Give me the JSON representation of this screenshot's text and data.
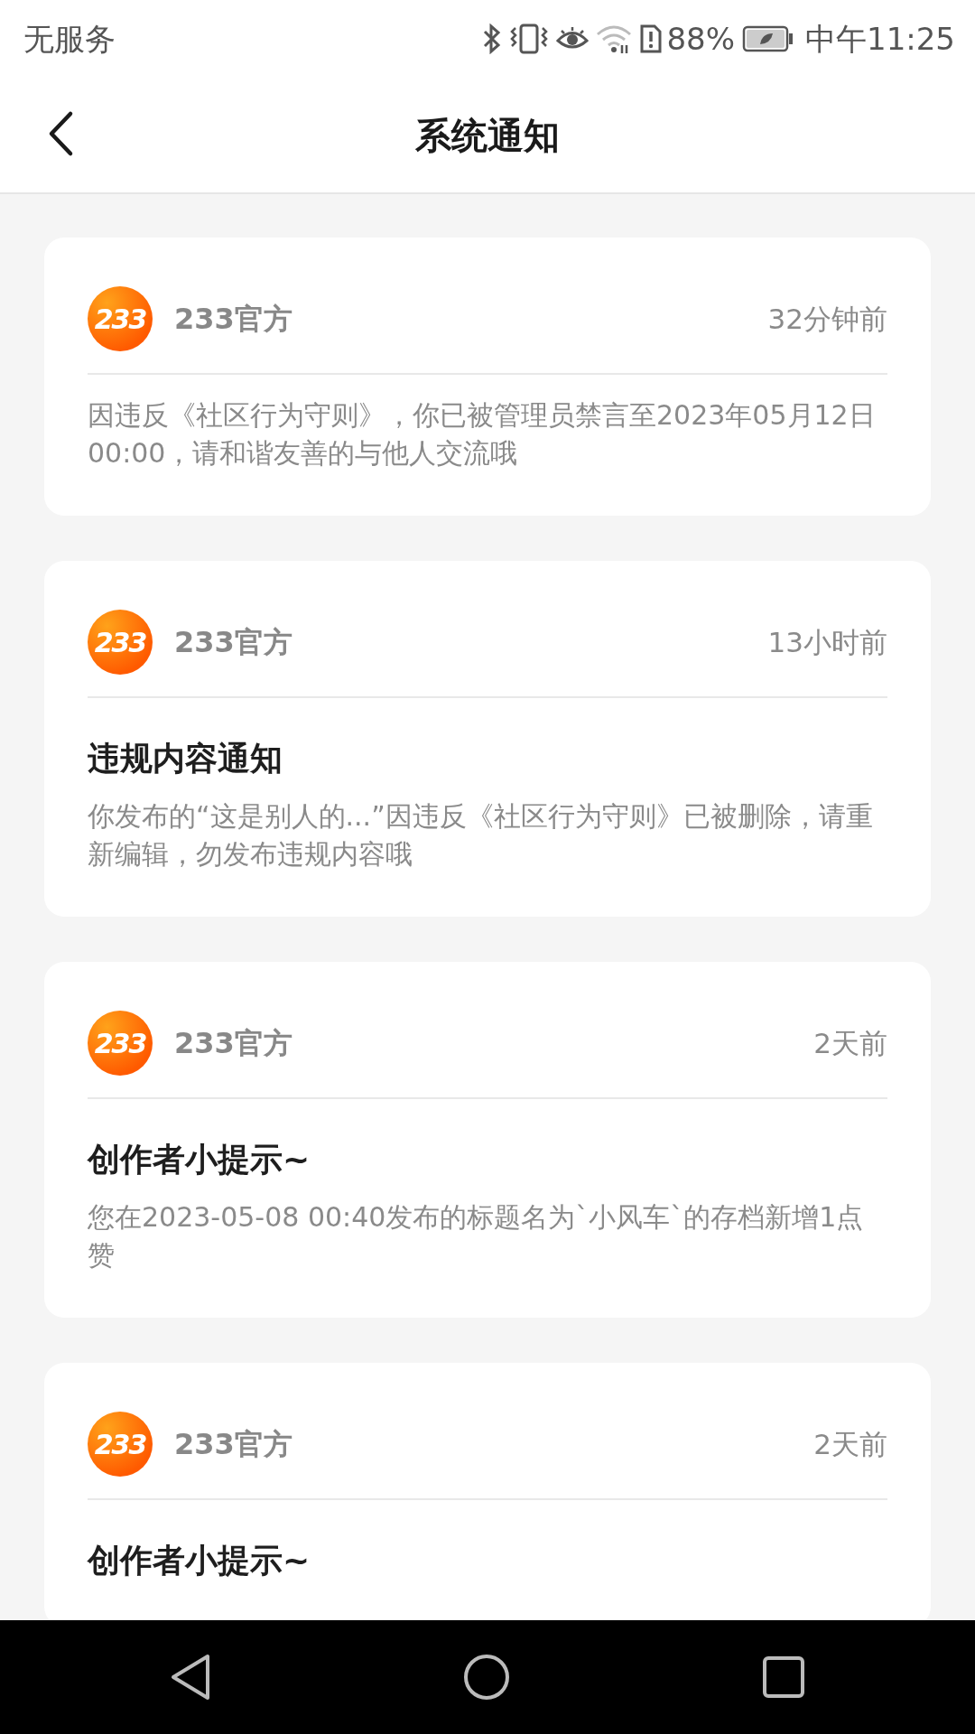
{
  "status_bar": {
    "carrier": "无服务",
    "battery_percent": "88%",
    "time": "中午11:25"
  },
  "header": {
    "title": "系统通知"
  },
  "notifications": [
    {
      "avatar_text": "233",
      "sender": "233官方",
      "time": "32分钟前",
      "body": "因违反《社区行为守则》，你已被管理员禁言至2023年05月12日 00:00，请和谐友善的与他人交流哦"
    },
    {
      "avatar_text": "233",
      "sender": "233官方",
      "time": "13小时前",
      "title": "违规内容通知",
      "body": "你发布的“这是别人的...”因违反《社区行为守则》已被删除，请重新编辑，勿发布违规内容哦"
    },
    {
      "avatar_text": "233",
      "sender": "233官方",
      "time": "2天前",
      "title": "创作者小提示~",
      "body": "您在2023-05-08 00:40发布的标题名为`小风车`的存档新增1点赞"
    },
    {
      "avatar_text": "233",
      "sender": "233官方",
      "time": "2天前",
      "title": "创作者小提示~"
    }
  ]
}
